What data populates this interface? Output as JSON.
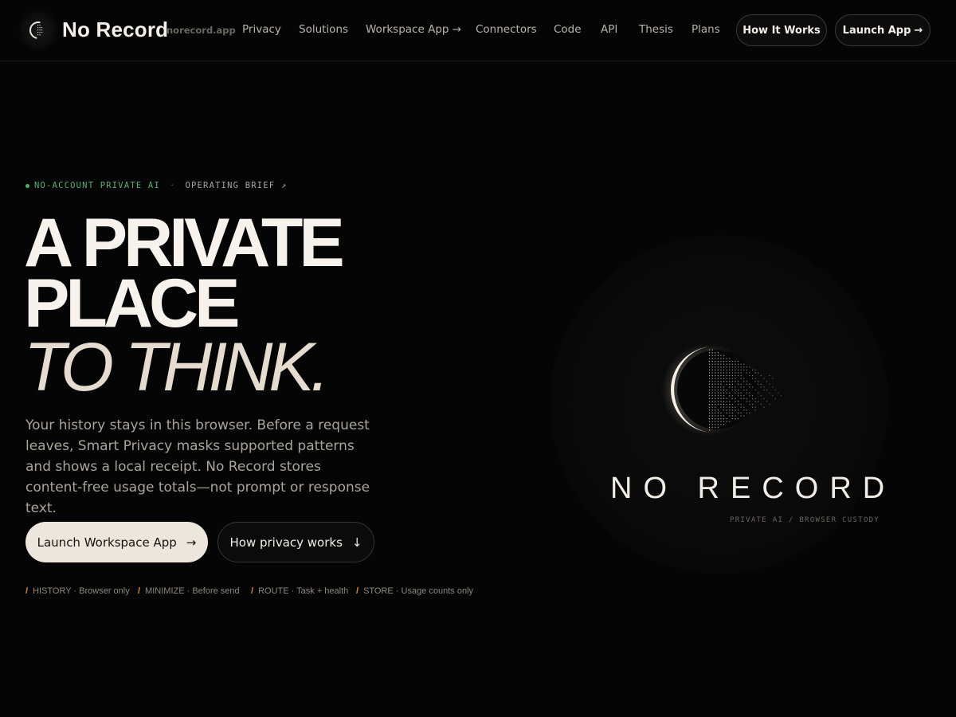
{
  "header": {
    "brand": "No Record",
    "domain": "norecord.app",
    "links": [
      {
        "id": "privacy",
        "label": "Privacy"
      },
      {
        "id": "solutions",
        "label": "Solutions"
      },
      {
        "id": "workspace-app",
        "label": "Workspace App →"
      },
      {
        "id": "connectors",
        "label": "Connectors"
      },
      {
        "id": "code",
        "label": "Code"
      },
      {
        "id": "api",
        "label": "API"
      },
      {
        "id": "thesis",
        "label": "Thesis"
      },
      {
        "id": "plans",
        "label": "Plans"
      }
    ],
    "how_it_works": "How It Works",
    "launch_app": "Launch App",
    "launch_arrow": "→"
  },
  "hero": {
    "eyebrow_status": "NO-ACCOUNT PRIVATE AI",
    "eyebrow_sep": "·",
    "eyebrow_link": "OPERATING BRIEF ↗",
    "headline_1": "A PRIVATE",
    "headline_2": "PLACE",
    "headline_3": "TO THINK.",
    "lede": "Your history stays in this browser. Before a request leaves, Smart Privacy masks supported patterns and shows a local receipt. No Record stores content-free usage totals—not prompt or response text.",
    "cta_primary": "Launch Workspace App",
    "cta_primary_arrow": "→",
    "cta_secondary": "How privacy works",
    "cta_secondary_arrow": "↓",
    "facts": [
      {
        "key": "HISTORY",
        "value": "Browser only"
      },
      {
        "key": "MINIMIZE",
        "value": "Before send"
      },
      {
        "key": "ROUTE",
        "value": "Task + health"
      },
      {
        "key": "STORE",
        "value": "Usage counts only"
      }
    ]
  },
  "visual": {
    "wordmark": "NO RECORD",
    "tagline": "PRIVATE AI / BROWSER CUSTODY"
  },
  "colors": {
    "background": "#050505",
    "accent_green": "#58b074",
    "accent_orange": "#e08a3a",
    "cream": "#ede6dc"
  }
}
